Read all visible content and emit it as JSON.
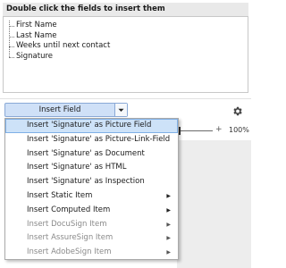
{
  "panel": {
    "header": "Double click the fields to insert them",
    "fields": [
      "First Name",
      "Last Name",
      "Weeks until next contact",
      "Signature"
    ]
  },
  "toolbar": {
    "insert_button_label": "Insert Field",
    "zoom_level": "100%",
    "zoom_plus": "+"
  },
  "menu": {
    "items": [
      {
        "label": "Insert 'Signature' as Picture Field",
        "highlighted": true,
        "disabled": false,
        "submenu": false
      },
      {
        "label": "Insert 'Signature' as Picture-Link-Field",
        "highlighted": false,
        "disabled": false,
        "submenu": false
      },
      {
        "label": "Insert 'Signature' as Document",
        "highlighted": false,
        "disabled": false,
        "submenu": false
      },
      {
        "label": "Insert 'Signature' as HTML",
        "highlighted": false,
        "disabled": false,
        "submenu": false
      },
      {
        "label": "Insert 'Signature' as Inspection",
        "highlighted": false,
        "disabled": false,
        "submenu": false
      },
      {
        "label": "Insert Static Item",
        "highlighted": false,
        "disabled": false,
        "submenu": true
      },
      {
        "label": "Insert Computed Item",
        "highlighted": false,
        "disabled": false,
        "submenu": true
      },
      {
        "label": "Insert DocuSign Item",
        "highlighted": false,
        "disabled": true,
        "submenu": true
      },
      {
        "label": "Insert AssureSign Item",
        "highlighted": false,
        "disabled": true,
        "submenu": true
      },
      {
        "label": "Insert AdobeSign Item",
        "highlighted": false,
        "disabled": true,
        "submenu": true
      }
    ],
    "submenu_glyph": "▶"
  },
  "icons": {
    "dropdown": "chevron-down-icon",
    "settings": "gear-icon"
  },
  "colors": {
    "highlight_bg": "#cde2f8",
    "button_bg": "#cfe0f7",
    "disabled_text": "#8a8a8a"
  }
}
